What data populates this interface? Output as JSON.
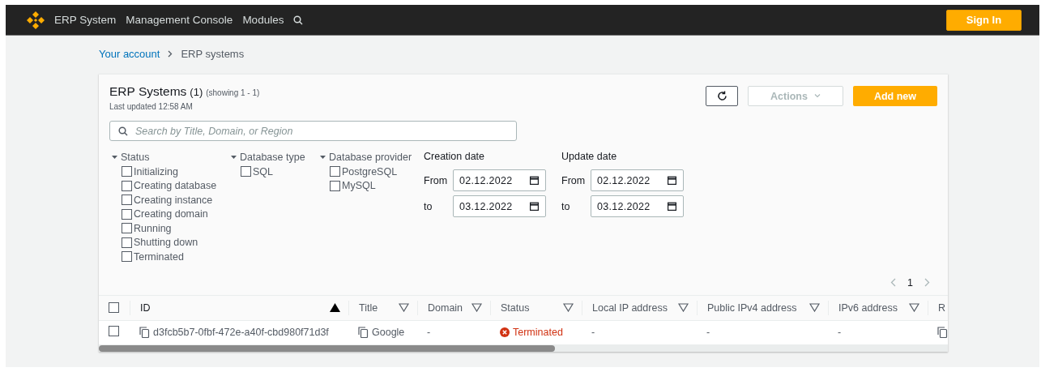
{
  "nav": {
    "brand": "ERP System",
    "links": [
      "Management Console",
      "Modules"
    ],
    "sign_in": "Sign In"
  },
  "breadcrumb": [
    {
      "label": "Your account",
      "link": true
    },
    {
      "label": "ERP systems",
      "link": false
    }
  ],
  "panel": {
    "title": "ERP Systems",
    "count": "(1)",
    "showing": "(showing 1 - 1)",
    "updated": "Last updated 12:58 AM",
    "actions": {
      "label": "Actions",
      "disabled": true
    },
    "add": "Add new"
  },
  "search": {
    "placeholder": "Search by Title, Domain, or Region"
  },
  "filters": [
    {
      "title": "Status",
      "expanded": true,
      "options": [
        {
          "label": "Initializing",
          "checked": false
        },
        {
          "label": "Creating database",
          "checked": false
        },
        {
          "label": "Creating instance",
          "checked": false
        },
        {
          "label": "Creating domain",
          "checked": false
        },
        {
          "label": "Running",
          "checked": false
        },
        {
          "label": "Shutting down",
          "checked": false
        },
        {
          "label": "Terminated",
          "checked": false
        }
      ]
    },
    {
      "title": "Database type",
      "expanded": true,
      "options": [
        {
          "label": "SQL",
          "checked": false
        }
      ]
    },
    {
      "title": "Database provider",
      "expanded": true,
      "options": [
        {
          "label": "PostgreSQL",
          "checked": false
        },
        {
          "label": "MySQL",
          "checked": false
        }
      ]
    }
  ],
  "date_filters": [
    {
      "title": "Creation date",
      "from_label": "From",
      "from": "02.12.2022",
      "to_label": "to",
      "to": "03.12.2022"
    },
    {
      "title": "Update date",
      "from_label": "From",
      "from": "02.12.2022",
      "to_label": "to",
      "to": "03.12.2022"
    }
  ],
  "pagination": {
    "pages": [
      {
        "label": "1",
        "selected": true
      }
    ]
  },
  "table": {
    "all_checked": false,
    "columns": [
      {
        "label": "ID",
        "sorted": true
      },
      {
        "label": "Title",
        "sorted": false
      },
      {
        "label": "Domain",
        "sorted": false
      },
      {
        "label": "Status",
        "sorted": false
      },
      {
        "label": "Local IP address",
        "sorted": false
      },
      {
        "label": "Public IPv4 address",
        "sorted": false
      },
      {
        "label": "IPv6 address",
        "sorted": false
      },
      {
        "label": "R",
        "sorted": false
      }
    ],
    "rows": [
      {
        "checked": false,
        "cells": [
          {
            "kind": "copy",
            "text": "d3fcb5b7-0fbf-472e-a40f-cbd980f71d3f"
          },
          {
            "kind": "copy",
            "text": "Google"
          },
          {
            "kind": "plain",
            "text": "-"
          },
          {
            "kind": "error",
            "text": "Terminated"
          },
          {
            "kind": "plain",
            "text": "-"
          },
          {
            "kind": "plain",
            "text": "-"
          },
          {
            "kind": "plain",
            "text": "-"
          },
          {
            "kind": "copy"
          }
        ]
      }
    ]
  }
}
